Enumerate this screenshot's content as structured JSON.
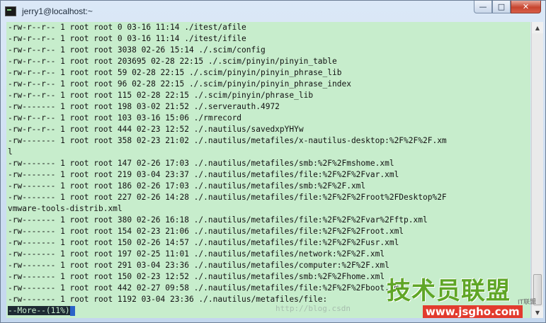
{
  "window": {
    "title": "jerry1@localhost:~",
    "controls": {
      "minimize": "—",
      "maximize": "□",
      "close": "✕"
    }
  },
  "terminal": {
    "lines": [
      "-rw-r--r-- 1 root root 0 03-16 11:14 ./itest/afile",
      "-rw-r--r-- 1 root root 0 03-16 11:14 ./itest/ifile",
      "-rw-r--r-- 1 root root 3038 02-26 15:14 ./.scim/config",
      "-rw-r--r-- 1 root root 203695 02-28 22:15 ./.scim/pinyin/pinyin_table",
      "-rw-r--r-- 1 root root 59 02-28 22:15 ./.scim/pinyin/pinyin_phrase_lib",
      "-rw-r--r-- 1 root root 96 02-28 22:15 ./.scim/pinyin/pinyin_phrase_index",
      "-rw-r--r-- 1 root root 115 02-28 22:15 ./.scim/pinyin/phrase_lib",
      "-rw------- 1 root root 198 03-02 21:52 ./.serverauth.4972",
      "-rw-r--r-- 1 root root 103 03-16 15:06 ./rmrecord",
      "-rw-r--r-- 1 root root 444 02-23 12:52 ./.nautilus/savedxpYHYw",
      "-rw------- 1 root root 358 02-23 21:02 ./.nautilus/metafiles/x-nautilus-desktop:%2F%2F%2F.xm",
      "l",
      "-rw------- 1 root root 147 02-26 17:03 ./.nautilus/metafiles/smb:%2F%2Fmshome.xml",
      "-rw------- 1 root root 219 03-04 23:37 ./.nautilus/metafiles/file:%2F%2F%2Fvar.xml",
      "-rw------- 1 root root 186 02-26 17:03 ./.nautilus/metafiles/smb:%2F%2F.xml",
      "-rw------- 1 root root 227 02-26 14:28 ./.nautilus/metafiles/file:%2F%2F%2Froot%2FDesktop%2F",
      "vmware-tools-distrib.xml",
      "-rw------- 1 root root 380 02-26 16:18 ./.nautilus/metafiles/file:%2F%2F%2Fvar%2Fftp.xml",
      "-rw------- 1 root root 154 02-23 21:06 ./.nautilus/metafiles/file:%2F%2F%2Froot.xml",
      "-rw------- 1 root root 150 02-26 14:57 ./.nautilus/metafiles/file:%2F%2F%2Fusr.xml",
      "-rw------- 1 root root 197 02-25 11:01 ./.nautilus/metafiles/network:%2F%2F.xml",
      "-rw------- 1 root root 291 03-04 23:36 ./.nautilus/metafiles/computer:%2F%2F.xml",
      "-rw------- 1 root root 150 02-23 12:52 ./.nautilus/metafiles/smb:%2F%2Fhome.xml",
      "-rw------- 1 root root 442 02-27 09:58 ./.nautilus/metafiles/file:%2F%2F%2Fboot.xml",
      "-rw------- 1 root root 1192 03-04 23:36 ./.nautilus/metafiles/file:"
    ],
    "more_prompt": "--More--(11%)"
  },
  "watermark": {
    "url": "http://blog.csdn",
    "logo": "技术员联盟",
    "site": "www.jsgho.com",
    "corner": "IT联盟"
  }
}
